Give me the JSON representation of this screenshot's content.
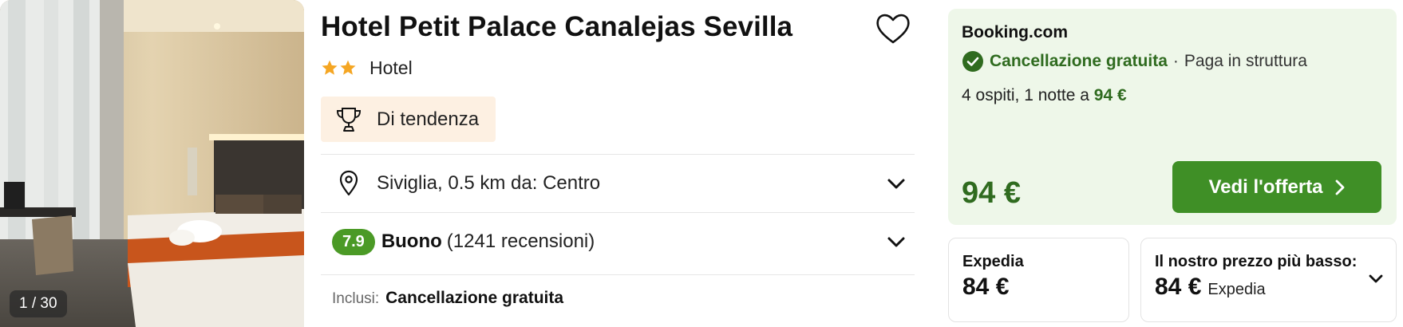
{
  "photo": {
    "counter": "1 / 30"
  },
  "hotel": {
    "name": "Hotel Petit Palace Canalejas Sevilla",
    "stars": 2,
    "type": "Hotel",
    "badge": "Di tendenza",
    "location": "Siviglia, 0.5 km da: Centro",
    "rating_score": "7.9",
    "rating_word": "Buono",
    "rating_count": "(1241 recensioni)",
    "included_label": "Inclusi:",
    "included_value": "Cancellazione gratuita"
  },
  "offer": {
    "provider": "Booking.com",
    "cancellation": "Cancellazione gratuita",
    "separator": "·",
    "payment": "Paga in struttura",
    "guests_text": "4 ospiti, 1 notte a",
    "guests_price": "94 €",
    "price": "94 €",
    "cta": "Vedi l'offerta"
  },
  "alt_offers": [
    {
      "label": "Expedia",
      "price": "84 €"
    },
    {
      "label": "Il nostro prezzo più basso:",
      "price": "84 €",
      "provider": "Expedia"
    }
  ],
  "colors": {
    "accent_green": "#3f8f26",
    "dark_green": "#2f6b1f",
    "offer_bg": "#eef7e9",
    "badge_bg": "#fdf0e2",
    "star": "#f5a623"
  },
  "icons": [
    "heart-icon",
    "star-icon",
    "trophy-icon",
    "location-pin-icon",
    "chevron-down-icon",
    "check-circle-icon",
    "chevron-right-icon"
  ]
}
